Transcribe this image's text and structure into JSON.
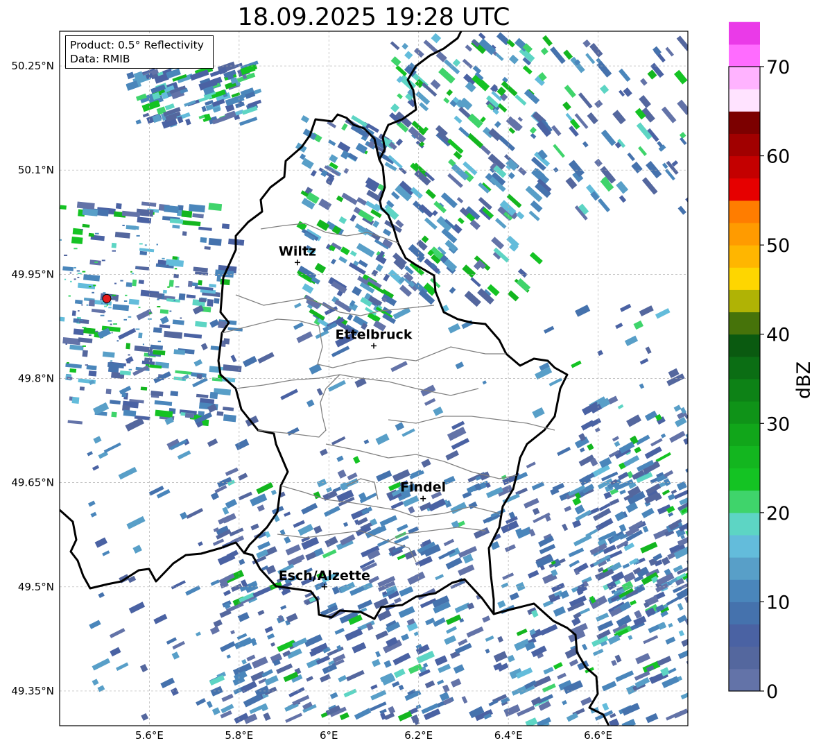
{
  "title": "18.09.2025 19:28 UTC",
  "info": {
    "product": "Product: 0.5° Reflectivity",
    "source": "Data: RMIB"
  },
  "map": {
    "lon_range": [
      5.4,
      6.8
    ],
    "lat_range": [
      49.3,
      50.3
    ],
    "lon_ticks": [
      {
        "value": 5.6,
        "label": "5.6°E"
      },
      {
        "value": 5.8,
        "label": "5.8°E"
      },
      {
        "value": 6.0,
        "label": "6°E"
      },
      {
        "value": 6.2,
        "label": "6.2°E"
      },
      {
        "value": 6.4,
        "label": "6.4°E"
      },
      {
        "value": 6.6,
        "label": "6.6°E"
      }
    ],
    "lat_ticks": [
      {
        "value": 50.25,
        "label": "50.25°N"
      },
      {
        "value": 50.1,
        "label": "50.1°N"
      },
      {
        "value": 49.95,
        "label": "49.95°N"
      },
      {
        "value": 49.8,
        "label": "49.8°N"
      },
      {
        "value": 49.65,
        "label": "49.65°N"
      },
      {
        "value": 49.5,
        "label": "49.5°N"
      },
      {
        "value": 49.35,
        "label": "49.35°N"
      }
    ],
    "grid": true,
    "cities": [
      {
        "name": "Wiltz",
        "lon": 5.93,
        "lat": 49.967
      },
      {
        "name": "Ettelbruck",
        "lon": 6.1,
        "lat": 49.847
      },
      {
        "name": "Findel",
        "lon": 6.21,
        "lat": 49.627
      },
      {
        "name": "Esch/Alzette",
        "lon": 5.99,
        "lat": 49.5
      }
    ],
    "radar_site": {
      "lon": 5.505,
      "lat": 49.915,
      "color": "#e31a1c"
    }
  },
  "colorbar": {
    "label": "dBZ",
    "min": 0,
    "max": 70,
    "step": 2.5,
    "tick_values": [
      0,
      10,
      20,
      30,
      40,
      50,
      60,
      70
    ],
    "tick_labels": [
      "0",
      "10",
      "20",
      "30",
      "40",
      "50",
      "60",
      "70"
    ],
    "colors": [
      "#6373a8",
      "#54679e",
      "#4a62a3",
      "#4572ad",
      "#4a86bb",
      "#589fc8",
      "#63bcdb",
      "#5dd5c4",
      "#3fd46b",
      "#14c323",
      "#13b61f",
      "#11a61a",
      "#0f9318",
      "#0d8216",
      "#0b6e14",
      "#0a5a10",
      "#46730a",
      "#b0b305",
      "#fed600",
      "#ffb600",
      "#ff9b00",
      "#ff7d00",
      "#e60000",
      "#c40000",
      "#a10000",
      "#7c0000",
      "#ffe3ff",
      "#ffb3ff",
      "#ff6cff",
      "#ea3ae8"
    ]
  }
}
